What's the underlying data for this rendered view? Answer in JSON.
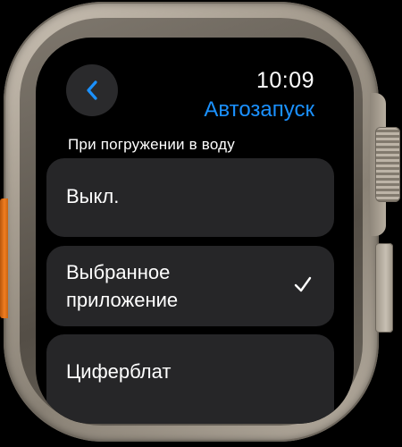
{
  "status": {
    "time": "10:09"
  },
  "header": {
    "title": "Автозапуск",
    "back_icon": "chevron-left-icon"
  },
  "section": {
    "label": "При погружении в воду"
  },
  "options": [
    {
      "label": "Выкл.",
      "selected": false
    },
    {
      "label": "Выбранное приложение",
      "selected": true
    },
    {
      "label": "Циферблат",
      "selected": false
    }
  ],
  "colors": {
    "accent": "#1b91ff",
    "row_background": "#262628",
    "screen_background": "#000000",
    "action_button": "#f07d21"
  }
}
